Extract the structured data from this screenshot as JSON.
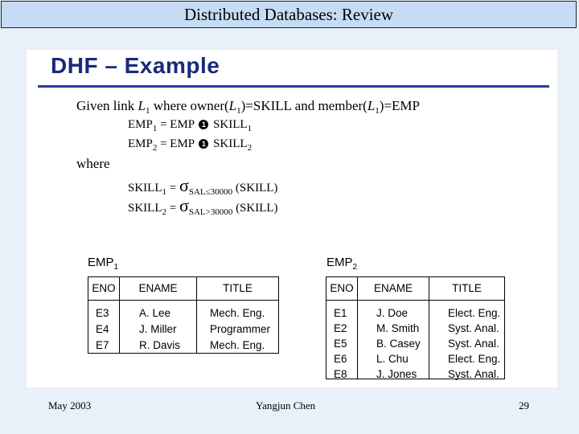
{
  "slide_title": "Distributed Databases: Review",
  "heading": "DHF – Example",
  "given": {
    "pre": "Given link ",
    "L": "L",
    "one": "1",
    "mid1": " where owner(",
    "mid2": ")=SKILL and member(",
    "end": ")=EMP"
  },
  "emp_defs": [
    {
      "name": "EMP",
      "sub": "1",
      "rhs": " = EMP ",
      "op": "1",
      "skill": " SKILL",
      "ssub": "1"
    },
    {
      "name": "EMP",
      "sub": "2",
      "rhs": " = EMP ",
      "op": "1",
      "skill": " SKILL",
      "ssub": "2"
    }
  ],
  "where": "where",
  "skill_defs": [
    {
      "name": "SKILL",
      "sub": "1",
      "eq": " = ",
      "sigma": "σ",
      "cond": "SAL≤30000",
      "arg": " (SKILL)"
    },
    {
      "name": "SKILL",
      "sub": "2",
      "eq": " = ",
      "sigma": "σ",
      "cond": "SAL>30000",
      "arg": " (SKILL)"
    }
  ],
  "tables": [
    {
      "name": "EMP",
      "sub": "1",
      "columns": [
        "ENO",
        "ENAME",
        "TITLE"
      ],
      "rows": [
        [
          "E3",
          "A. Lee",
          "Mech. Eng."
        ],
        [
          "E4",
          "J. Miller",
          "Programmer"
        ],
        [
          "E7",
          "R. Davis",
          "Mech. Eng."
        ]
      ]
    },
    {
      "name": "EMP",
      "sub": "2",
      "columns": [
        "ENO",
        "ENAME",
        "TITLE"
      ],
      "rows": [
        [
          "E1",
          "J. Doe",
          "Elect. Eng."
        ],
        [
          "E2",
          "M. Smith",
          "Syst. Anal."
        ],
        [
          "E5",
          "B. Casey",
          "Syst. Anal."
        ],
        [
          "E6",
          "L. Chu",
          "Elect. Eng."
        ],
        [
          "E8",
          "J. Jones",
          "Syst. Anal."
        ]
      ]
    }
  ],
  "footer": {
    "date": "May 2003",
    "author": "Yangjun Chen",
    "page": "29"
  },
  "colors": {
    "title_bg": "#c6dcf4",
    "page_bg": "#e8f0fa",
    "heading": "#1a2a7a",
    "rule": "#2a3a9a"
  }
}
